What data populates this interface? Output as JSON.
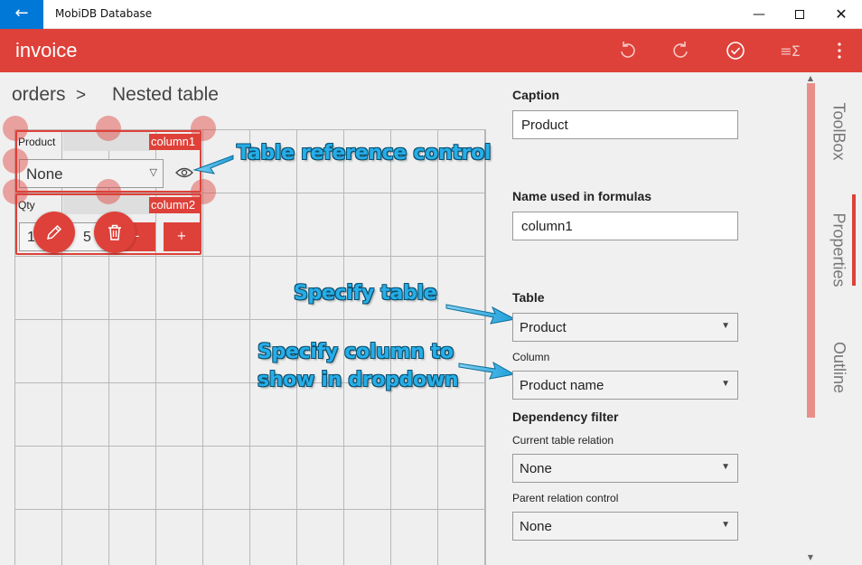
{
  "window": {
    "title": "MobiDB Database",
    "back_icon": "back-arrow-icon",
    "minimize_icon": "minimize-icon",
    "maximize_icon": "maximize-icon",
    "close_icon": "close-icon"
  },
  "appbar": {
    "title": "invoice",
    "icons": [
      "undo-icon",
      "redo-icon",
      "check-icon",
      "formula-icon",
      "more-icon"
    ],
    "color": "#de4139"
  },
  "breadcrumb": {
    "parent": "orders",
    "separator": ">",
    "current": "Nested table"
  },
  "designer": {
    "controls": [
      {
        "label": "Product",
        "column_name": "column1",
        "value": "None",
        "icon": "eye-icon"
      },
      {
        "label": "Qty",
        "column_name": "column2",
        "value_partial_start": "1",
        "value_partial_end": "5",
        "minus_label": "-",
        "plus_label": "+"
      }
    ],
    "fab_icons": [
      "pencil-icon",
      "trash-icon"
    ]
  },
  "annotations": {
    "table_reference": "Table reference control",
    "specify_table": "Specify table",
    "specify_column_line1": "Specify column to",
    "specify_column_line2": "show in dropdown"
  },
  "properties": {
    "caption_label": "Caption",
    "caption_value": "Product",
    "formula_name_label": "Name used in formulas",
    "formula_name_value": "column1",
    "table_label": "Table",
    "table_value": "Product",
    "column_label": "Column",
    "column_value": "Product name",
    "dependency_label": "Dependency filter",
    "current_relation_label": "Current table relation",
    "current_relation_value": "None",
    "parent_relation_label": "Parent relation control",
    "parent_relation_value": "None"
  },
  "side_tabs": {
    "toolbox": "ToolBox",
    "properties": "Properties",
    "outline": "Outline",
    "active": "Properties"
  }
}
